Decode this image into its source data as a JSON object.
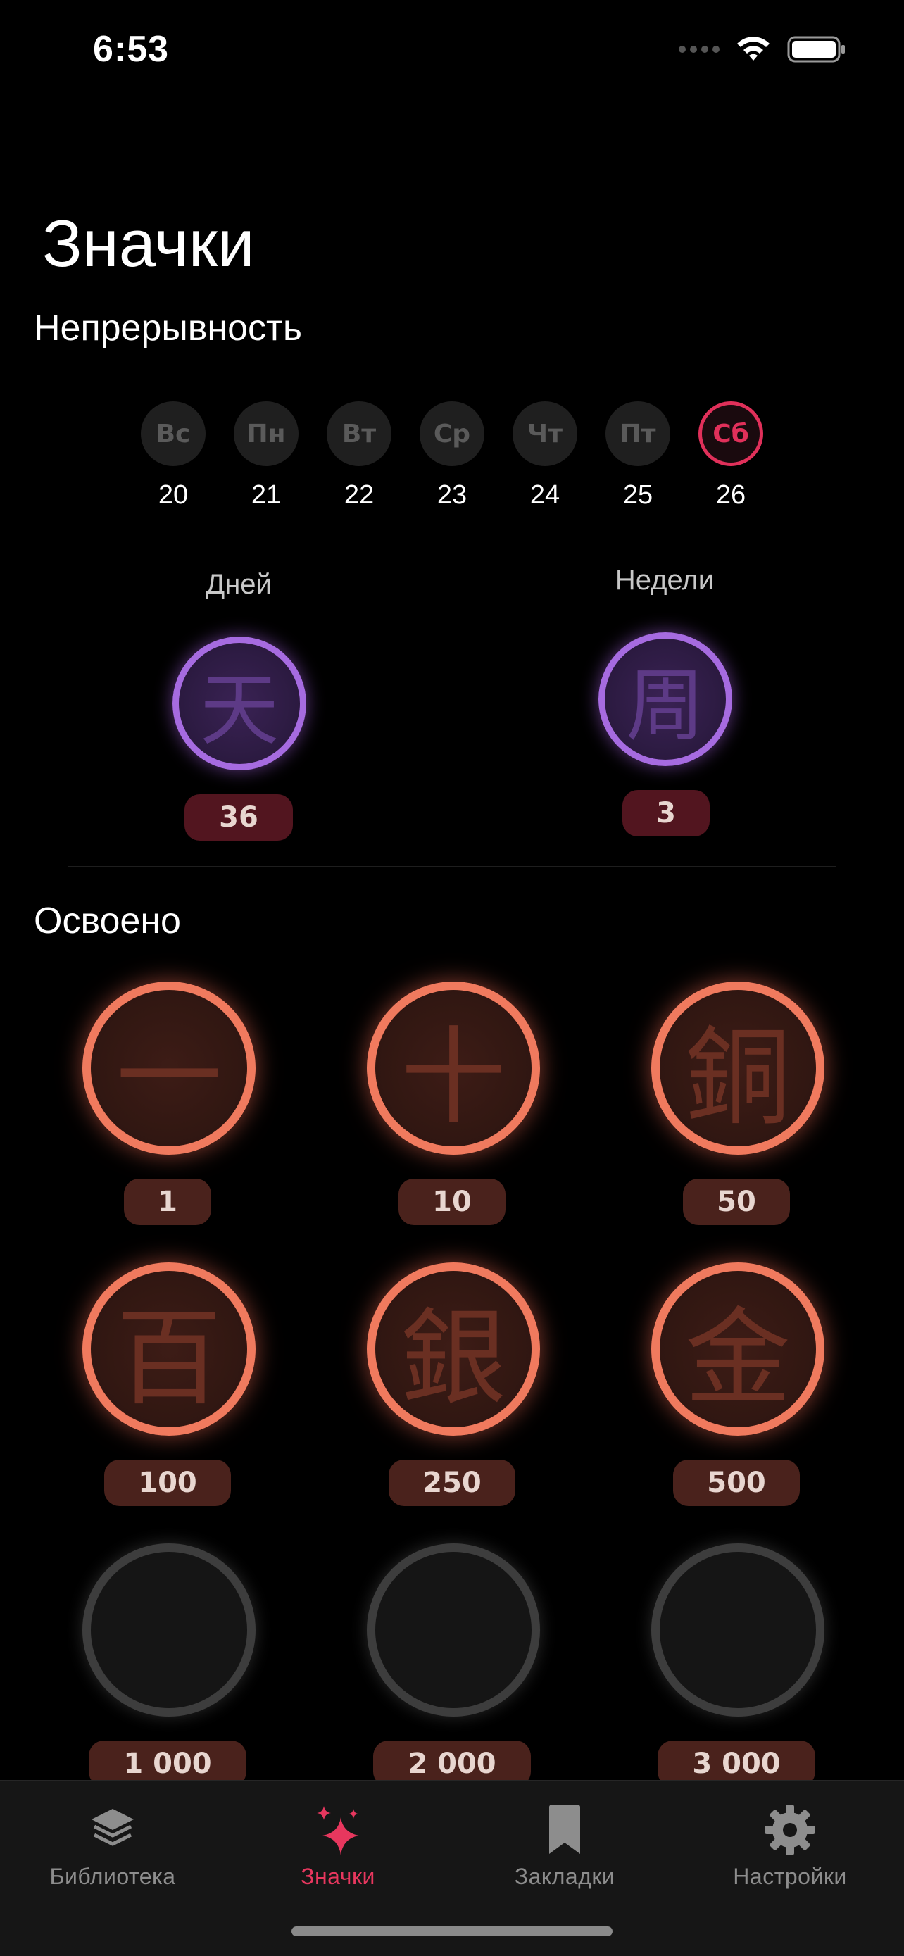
{
  "status_bar": {
    "time": "6:53"
  },
  "page_title": "Значки",
  "streak": {
    "section_title": "Непрерывность",
    "days": [
      {
        "abbr": "Вс",
        "num": "20",
        "active": false
      },
      {
        "abbr": "Пн",
        "num": "21",
        "active": false
      },
      {
        "abbr": "Вт",
        "num": "22",
        "active": false
      },
      {
        "abbr": "Ср",
        "num": "23",
        "active": false
      },
      {
        "abbr": "Чт",
        "num": "24",
        "active": false
      },
      {
        "abbr": "Пт",
        "num": "25",
        "active": false
      },
      {
        "abbr": "Сб",
        "num": "26",
        "active": true
      }
    ],
    "days_badge": {
      "label": "Дней",
      "glyph": "天",
      "count": "36"
    },
    "weeks_badge": {
      "label": "Недели",
      "glyph": "周",
      "count": "3"
    }
  },
  "mastered": {
    "section_title": "Освоено",
    "badges": [
      {
        "glyph": "一",
        "count": "1",
        "unlocked": true
      },
      {
        "glyph": "十",
        "count": "10",
        "unlocked": true
      },
      {
        "glyph": "銅",
        "count": "50",
        "unlocked": true
      },
      {
        "glyph": "百",
        "count": "100",
        "unlocked": true
      },
      {
        "glyph": "銀",
        "count": "250",
        "unlocked": true
      },
      {
        "glyph": "金",
        "count": "500",
        "unlocked": true
      },
      {
        "glyph": "",
        "count": "1 000",
        "unlocked": false
      },
      {
        "glyph": "",
        "count": "2 000",
        "unlocked": false
      },
      {
        "glyph": "",
        "count": "3 000",
        "unlocked": false
      }
    ]
  },
  "tab_bar": {
    "tabs": [
      {
        "label": "Библиотека",
        "icon": "stack-icon",
        "active": false
      },
      {
        "label": "Значки",
        "icon": "sparkles-icon",
        "active": true
      },
      {
        "label": "Закладки",
        "icon": "bookmark-icon",
        "active": false
      },
      {
        "label": "Настройки",
        "icon": "gear-icon",
        "active": false
      }
    ]
  },
  "colors": {
    "accent": "#e7375e",
    "streak_ring": "#a66be0",
    "mastered_ring": "#f07a5e",
    "locked_ring": "#3d3d3d"
  }
}
